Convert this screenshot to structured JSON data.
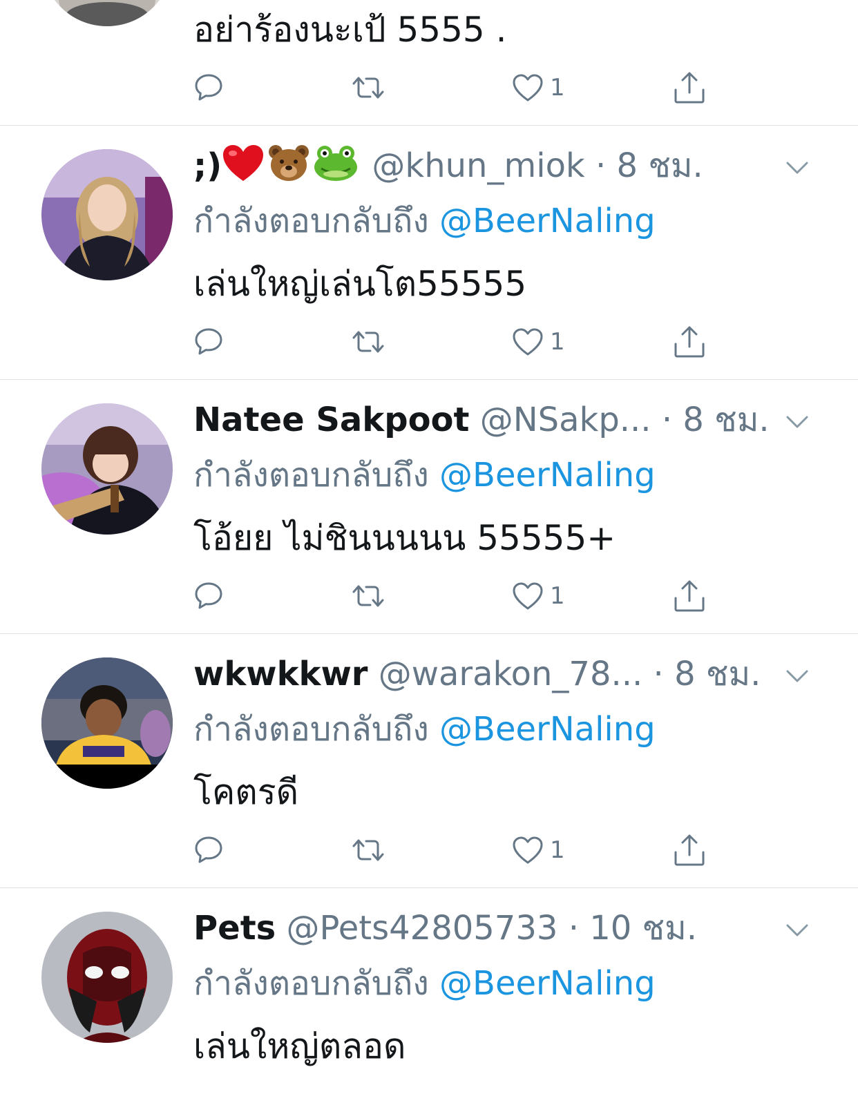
{
  "colors": {
    "link": "#1b95e0",
    "muted": "#657786",
    "text": "#14171a",
    "divider": "#dfe3e6"
  },
  "icons": {
    "reply": "reply-icon",
    "retweet": "retweet-icon",
    "like": "heart-icon",
    "share": "share-icon",
    "menu": "chevron-down-icon"
  },
  "tweets": [
    {
      "body": "อย่าร้องนะเป้ 5555 .",
      "like_count": "1"
    },
    {
      "display_name": ";)",
      "display_name_emoji": [
        "red-heart-emoji",
        "bear-emoji",
        "frog-emoji"
      ],
      "handle": "@khun_miok",
      "separator": "·",
      "time": "8 ชม.",
      "reply_prefix": "กำลังตอบกลับถึง",
      "reply_to": "@BeerNaling",
      "body": "เล่นใหญ่เล่นโต55555",
      "like_count": "1"
    },
    {
      "display_name": "Natee Sakpoot",
      "handle": "@NSakp...",
      "separator": "·",
      "time": "8 ชม.",
      "reply_prefix": "กำลังตอบกลับถึง",
      "reply_to": "@BeerNaling",
      "body": "โอ้ยย ไม่ชินนนนน 55555+",
      "like_count": "1"
    },
    {
      "display_name": "wkwkkwr",
      "handle": "@warakon_78...",
      "separator": "·",
      "time": "8 ชม.",
      "reply_prefix": "กำลังตอบกลับถึง",
      "reply_to": "@BeerNaling",
      "body": "โคตรดี",
      "like_count": "1"
    },
    {
      "display_name": "Pets",
      "handle": "@Pets42805733",
      "separator": "·",
      "time": "10 ชม.",
      "reply_prefix": "กำลังตอบกลับถึง",
      "reply_to": "@BeerNaling",
      "body": "เล่นใหญ่ตลอด"
    }
  ]
}
